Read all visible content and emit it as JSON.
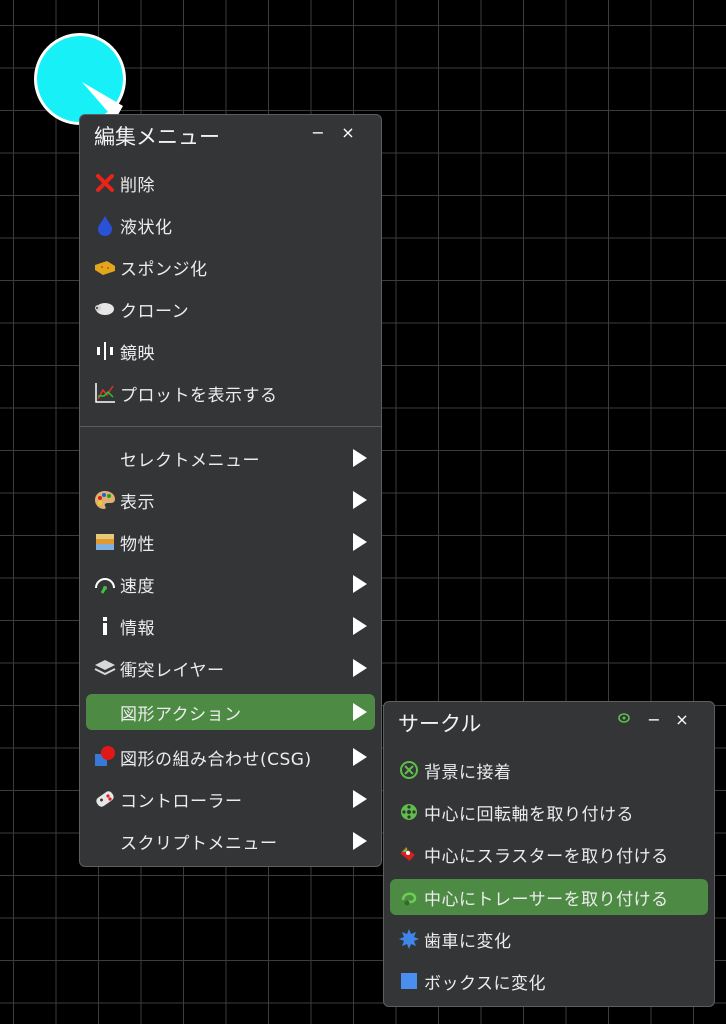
{
  "canvas": {
    "grid_color": "#3c3c3c",
    "circle_color": "#18f0f8"
  },
  "edit_menu": {
    "title": "編集メニュー",
    "minimize_label": "−",
    "close_label": "×",
    "actions": [
      {
        "label": "削除",
        "icon": "delete-x-icon"
      },
      {
        "label": "液状化",
        "icon": "liquid-drop-icon"
      },
      {
        "label": "スポンジ化",
        "icon": "sponge-icon"
      },
      {
        "label": "クローン",
        "icon": "sheep-clone-icon"
      },
      {
        "label": "鏡映",
        "icon": "mirror-icon"
      },
      {
        "label": "プロットを表示する",
        "icon": "plot-icon"
      }
    ],
    "submenus": [
      {
        "label": "セレクトメニュー",
        "icon": ""
      },
      {
        "label": "表示",
        "icon": "palette-icon"
      },
      {
        "label": "物性",
        "icon": "material-layers-icon"
      },
      {
        "label": "速度",
        "icon": "speedometer-icon"
      },
      {
        "label": "情報",
        "icon": "info-icon"
      },
      {
        "label": "衝突レイヤー",
        "icon": "layers-icon"
      },
      {
        "label": "図形アクション",
        "icon": "",
        "active": true
      },
      {
        "label": "図形の組み合わせ(CSG)",
        "icon": "csg-icon"
      },
      {
        "label": "コントローラー",
        "icon": "gamepad-icon"
      },
      {
        "label": "スクリプトメニュー",
        "icon": ""
      }
    ]
  },
  "circle_menu": {
    "title": "サークル",
    "minimize_label": "−",
    "close_label": "×",
    "items": [
      {
        "label": "背景に接着",
        "icon": "fixate-icon"
      },
      {
        "label": "中心に回転軸を取り付ける",
        "icon": "hinge-icon"
      },
      {
        "label": "中心にスラスターを取り付ける",
        "icon": "thruster-icon"
      },
      {
        "label": "中心にトレーサーを取り付ける",
        "icon": "tracer-icon",
        "active": true
      },
      {
        "label": "歯車に変化",
        "icon": "gear-icon"
      },
      {
        "label": "ボックスに変化",
        "icon": "box-icon"
      }
    ]
  },
  "colors": {
    "panel_bg": "#333537",
    "active_item": "#4d8a44",
    "text": "#ececec"
  }
}
